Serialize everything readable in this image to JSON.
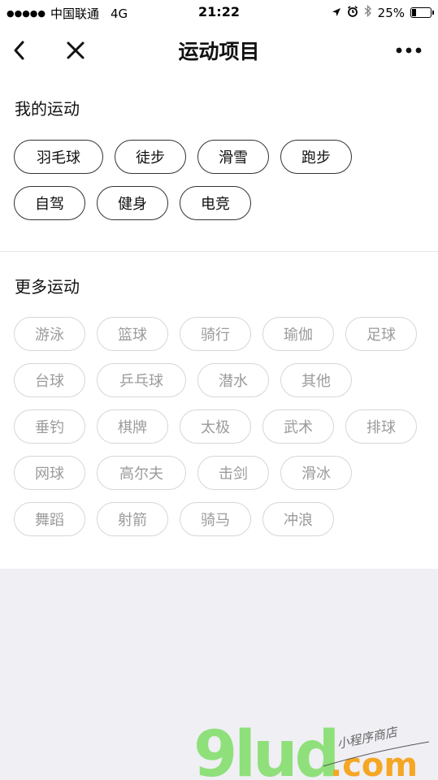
{
  "status_bar": {
    "signal_dots": "●●●●●",
    "carrier": "中国联通",
    "network": "4G",
    "time": "21:22",
    "battery_percent": "25%",
    "battery_level": 0.25,
    "icons": [
      "location-arrow-icon",
      "alarm-icon",
      "bluetooth-icon",
      "battery-icon"
    ]
  },
  "navbar": {
    "title": "运动项目",
    "icons": [
      "back-chevron-icon",
      "close-x-icon",
      "more-dots-icon"
    ]
  },
  "my_sports": {
    "title": "我的运动",
    "items": [
      "羽毛球",
      "徒步",
      "滑雪",
      "跑步",
      "自驾",
      "健身",
      "电竞"
    ]
  },
  "more_sports": {
    "title": "更多运动",
    "items": [
      "游泳",
      "篮球",
      "骑行",
      "瑜伽",
      "足球",
      "台球",
      "乒乓球",
      "潜水",
      "其他",
      "垂钓",
      "棋牌",
      "太极",
      "武术",
      "排球",
      "网球",
      "高尔夫",
      "击剑",
      "滑冰",
      "舞蹈",
      "射箭",
      "骑马",
      "冲浪"
    ]
  },
  "watermark": {
    "logo": "9lud.com",
    "slogan": "小程序商店"
  },
  "colors": {
    "chip_active_border": "#333333",
    "chip_inactive_border": "#d6d6d6",
    "chip_inactive_text": "#9b9b9b",
    "page_background": "#efeff4",
    "watermark_green": "#8fe07a",
    "watermark_orange": "#f5a623"
  }
}
